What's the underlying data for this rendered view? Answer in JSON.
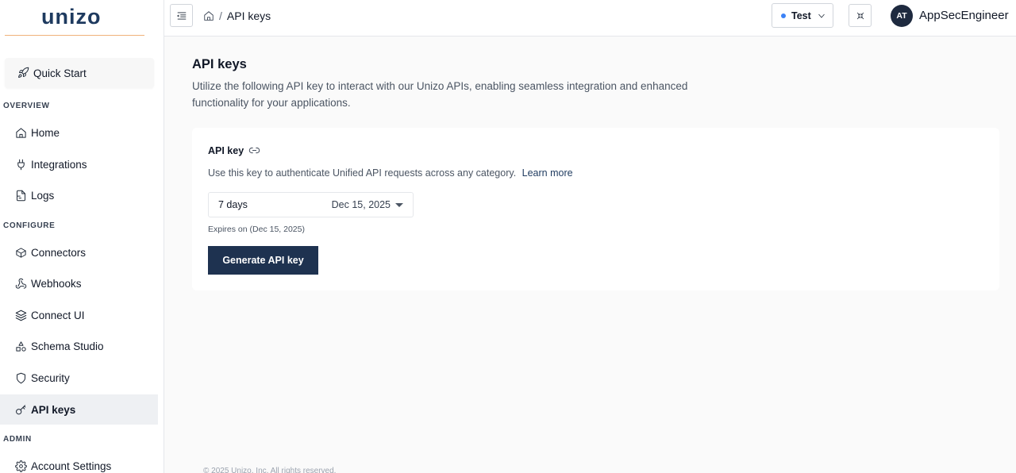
{
  "brand": {
    "logo_text": "unizo"
  },
  "sidebar": {
    "quick_start": "Quick Start",
    "sections": {
      "overview": "OVERVIEW",
      "configure": "CONFIGURE",
      "admin": "ADMIN"
    },
    "items": {
      "home": "Home",
      "integrations": "Integrations",
      "logs": "Logs",
      "connectors": "Connectors",
      "webhooks": "Webhooks",
      "connect_ui": "Connect UI",
      "schema_studio": "Schema Studio",
      "security": "Security",
      "api_keys": "API keys",
      "account_settings": "Account Settings"
    },
    "active_item": "api_keys"
  },
  "header": {
    "breadcrumb_separator": "/",
    "breadcrumb_current": "API keys",
    "environment": "Test",
    "environment_dot_color": "#3b82f6",
    "avatar_initials": "AT",
    "username": "AppSecEngineer"
  },
  "main": {
    "title": "API keys",
    "description": "Utilize the following API key to interact with our Unizo APIs, enabling seamless integration and enhanced functionality for your applications.",
    "card": {
      "title": "API key",
      "description": "Use this key to authenticate Unified API requests across any category.",
      "learn_more": "Learn more",
      "expiry_option": "7 days",
      "expiry_date": "Dec 15, 2025",
      "expires_note": "Expires on (Dec 15, 2025)",
      "generate_button": "Generate API key"
    }
  },
  "footer": {
    "text": "© 2025 Unizo, Inc. All rights reserved."
  },
  "colors": {
    "primary": "#1e3250",
    "accent_line": "#f0b27a"
  }
}
